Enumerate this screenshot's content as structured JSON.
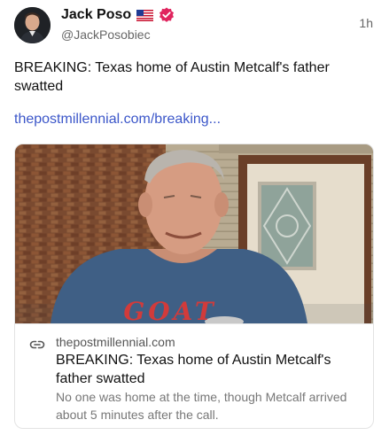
{
  "author": {
    "name": "Jack Poso",
    "handle": "@JackPosobiec",
    "time": "1h"
  },
  "post": {
    "text": "BREAKING: Texas home of Austin Metcalf's father swatted",
    "link": "thepostmillennial.com/breaking..."
  },
  "card": {
    "domain": "thepostmillennial.com",
    "title": "BREAKING: Texas home of Austin Metcalf's father swatted",
    "description": "No one was home at the time, though Metcalf arrived about 5 minutes after the call.",
    "shirt_text": "GOAT"
  },
  "colors": {
    "link": "#3b56c9",
    "verified": "#e0245e",
    "muted": "#666666"
  },
  "icons": {
    "flag": "us-flag-icon",
    "verified": "verified-badge-icon",
    "link": "link-icon"
  }
}
